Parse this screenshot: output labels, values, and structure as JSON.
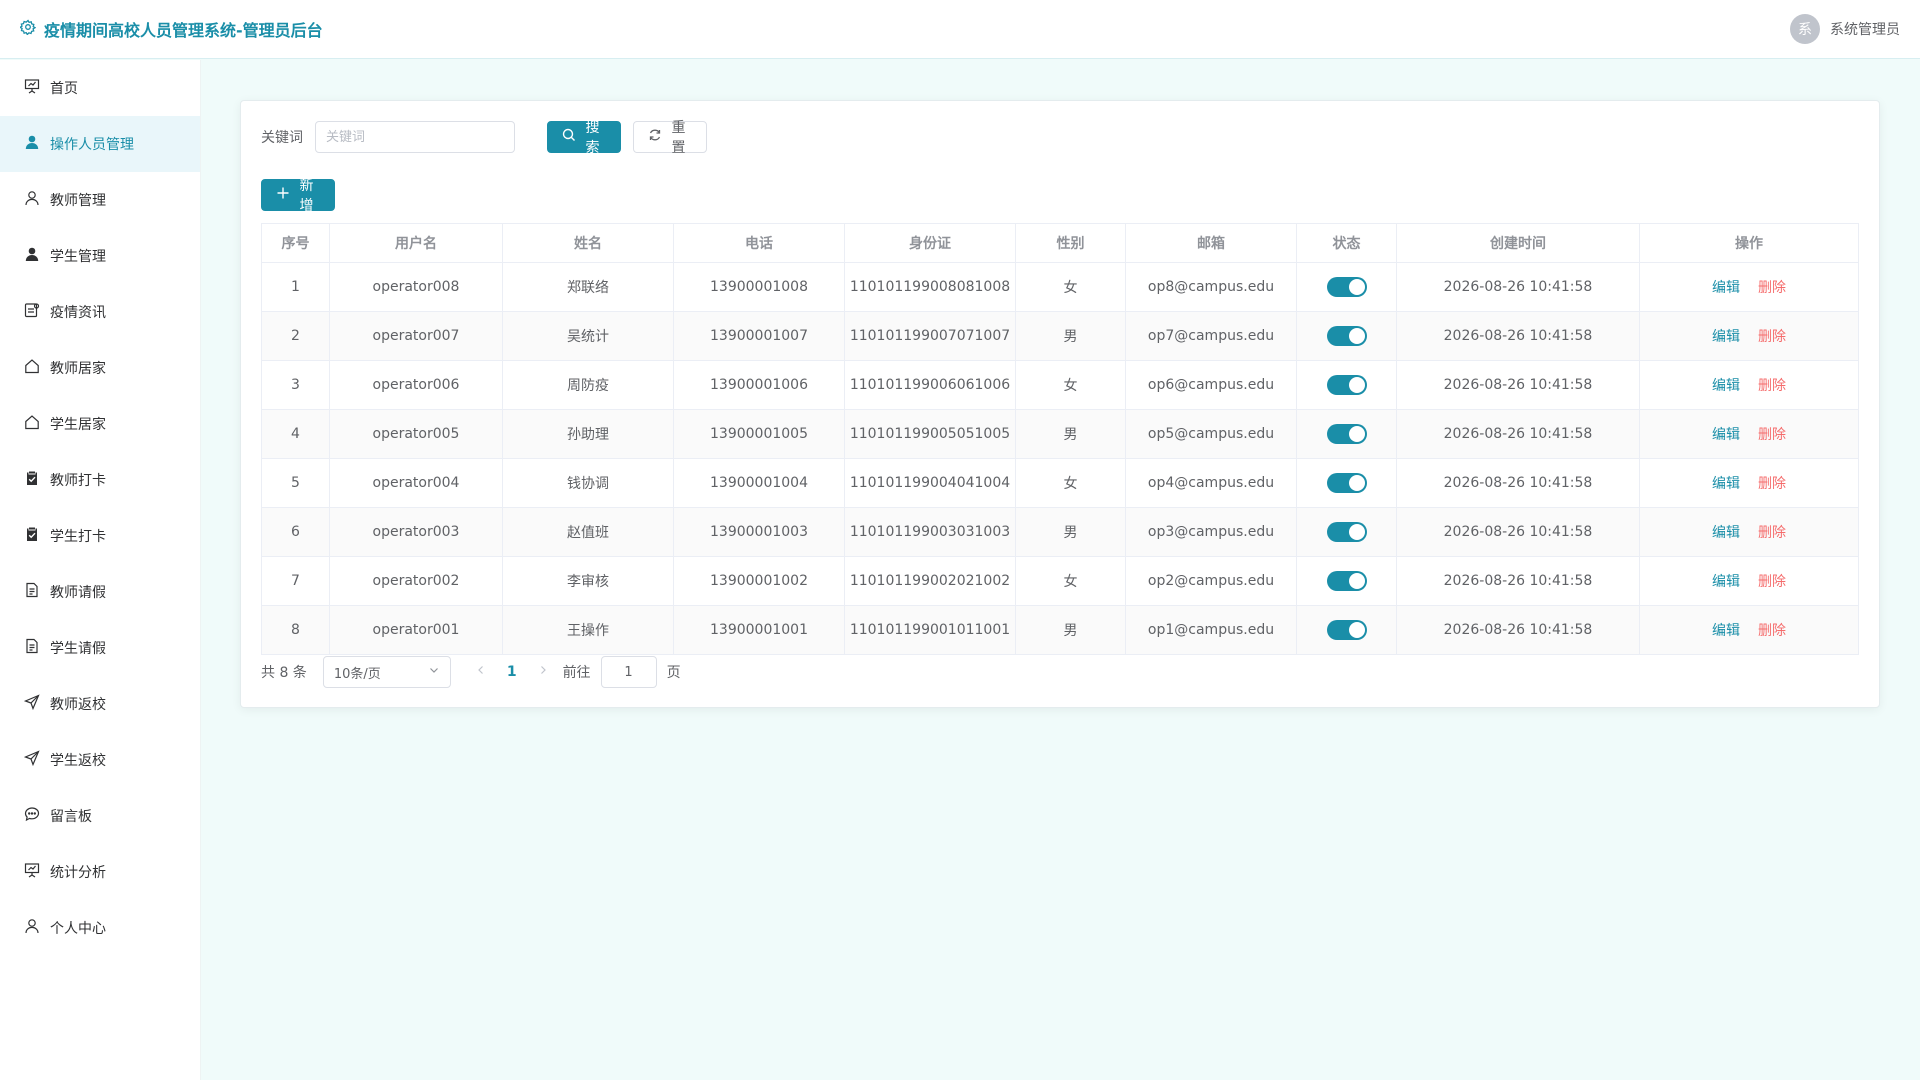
{
  "header": {
    "title": "疫情期间高校人员管理系统-管理员后台",
    "avatar_text": "系",
    "username": "系统管理员"
  },
  "sidebar": {
    "items": [
      {
        "label": "首页",
        "icon": "presentation-icon"
      },
      {
        "label": "操作人员管理",
        "icon": "user-filled-icon",
        "active": true
      },
      {
        "label": "教师管理",
        "icon": "user-icon"
      },
      {
        "label": "学生管理",
        "icon": "user-filled-icon"
      },
      {
        "label": "疫情资讯",
        "icon": "news-icon"
      },
      {
        "label": "教师居家",
        "icon": "house-icon"
      },
      {
        "label": "学生居家",
        "icon": "house-icon"
      },
      {
        "label": "教师打卡",
        "icon": "clipboard-check-icon"
      },
      {
        "label": "学生打卡",
        "icon": "clipboard-check-icon"
      },
      {
        "label": "教师请假",
        "icon": "document-icon"
      },
      {
        "label": "学生请假",
        "icon": "document-icon"
      },
      {
        "label": "教师返校",
        "icon": "send-icon"
      },
      {
        "label": "学生返校",
        "icon": "send-icon"
      },
      {
        "label": "留言板",
        "icon": "chat-icon"
      },
      {
        "label": "统计分析",
        "icon": "presentation-icon"
      },
      {
        "label": "个人中心",
        "icon": "user-icon"
      }
    ]
  },
  "search": {
    "label": "关键词",
    "placeholder": "关键词",
    "search_label": "搜索",
    "reset_label": "重置"
  },
  "toolbar": {
    "add_label": "新增"
  },
  "table": {
    "headers": [
      "序号",
      "用户名",
      "姓名",
      "电话",
      "身份证",
      "性别",
      "邮箱",
      "状态",
      "创建时间",
      "操作"
    ],
    "edit_label": "编辑",
    "delete_label": "删除",
    "rows": [
      {
        "no": "1",
        "username": "operator008",
        "name": "郑联络",
        "phone": "13900001008",
        "id_card": "110101199008081008",
        "gender": "女",
        "email": "op8@campus.edu",
        "status": true,
        "created": "2026-08-26 10:41:58"
      },
      {
        "no": "2",
        "username": "operator007",
        "name": "吴统计",
        "phone": "13900001007",
        "id_card": "110101199007071007",
        "gender": "男",
        "email": "op7@campus.edu",
        "status": true,
        "created": "2026-08-26 10:41:58"
      },
      {
        "no": "3",
        "username": "operator006",
        "name": "周防疫",
        "phone": "13900001006",
        "id_card": "110101199006061006",
        "gender": "女",
        "email": "op6@campus.edu",
        "status": true,
        "created": "2026-08-26 10:41:58"
      },
      {
        "no": "4",
        "username": "operator005",
        "name": "孙助理",
        "phone": "13900001005",
        "id_card": "110101199005051005",
        "gender": "男",
        "email": "op5@campus.edu",
        "status": true,
        "created": "2026-08-26 10:41:58"
      },
      {
        "no": "5",
        "username": "operator004",
        "name": "钱协调",
        "phone": "13900001004",
        "id_card": "110101199004041004",
        "gender": "女",
        "email": "op4@campus.edu",
        "status": true,
        "created": "2026-08-26 10:41:58"
      },
      {
        "no": "6",
        "username": "operator003",
        "name": "赵值班",
        "phone": "13900001003",
        "id_card": "110101199003031003",
        "gender": "男",
        "email": "op3@campus.edu",
        "status": true,
        "created": "2026-08-26 10:41:58"
      },
      {
        "no": "7",
        "username": "operator002",
        "name": "李审核",
        "phone": "13900001002",
        "id_card": "110101199002021002",
        "gender": "女",
        "email": "op2@campus.edu",
        "status": true,
        "created": "2026-08-26 10:41:58"
      },
      {
        "no": "8",
        "username": "operator001",
        "name": "王操作",
        "phone": "13900001001",
        "id_card": "110101199001011001",
        "gender": "男",
        "email": "op1@campus.edu",
        "status": true,
        "created": "2026-08-26 10:41:58"
      }
    ]
  },
  "pagination": {
    "total_text": "共 8 条",
    "page_size": "10条/页",
    "current_page": "1",
    "goto_label": "前往",
    "goto_value": "1",
    "page_unit": "页"
  },
  "colors": {
    "accent": "#1a8ea8",
    "danger": "#f56c6c",
    "background": "#f0fbfa"
  }
}
